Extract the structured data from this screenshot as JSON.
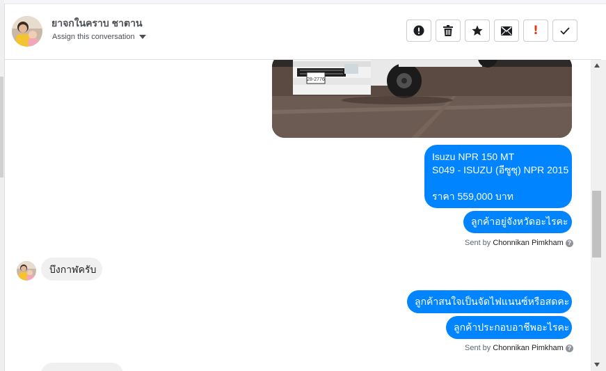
{
  "header": {
    "contact_name": "ยาจกในคราบ ชาตาน",
    "assign_label": "Assign this conversation",
    "actions": [
      {
        "icon": "exclamation-circle-icon",
        "name": "mark-spam-button"
      },
      {
        "icon": "trash-icon",
        "name": "delete-button"
      },
      {
        "icon": "star-icon",
        "name": "star-button"
      },
      {
        "icon": "envelope-icon",
        "name": "mark-unread-button"
      },
      {
        "icon": "exclamation-icon",
        "name": "mark-important-button"
      },
      {
        "icon": "checkmark-icon",
        "name": "mark-done-button"
      }
    ],
    "important_glyph": "!"
  },
  "messages": {
    "outgoing_1": {
      "line1": "Isuzu NPR 150 MT",
      "line2": "S049 - ISUZU (อีซูซุ) NPR 2015",
      "line3": "ราคา 559,000 บาท"
    },
    "outgoing_2": "ลูกค้าอยู่จังหวัดอะไรคะ",
    "sent_by_1": {
      "prefix": "Sent by",
      "name": "Chonnikan Pimkham"
    },
    "incoming_1": "บึงกาฬครับ",
    "outgoing_3": "ลูกค้าสนใจเป็นจัดไฟแนนซ์หรือสดคะ",
    "outgoing_4": "ลูกค้าประกอบอาชีพอะไรคะ",
    "sent_by_2": {
      "prefix": "Sent by",
      "name": "Chonnikan Pimkham"
    },
    "help_glyph": "?"
  },
  "colors": {
    "outgoing_bubble": "#0084ff",
    "incoming_bubble": "#f1f0f0",
    "danger": "#e03a18"
  }
}
